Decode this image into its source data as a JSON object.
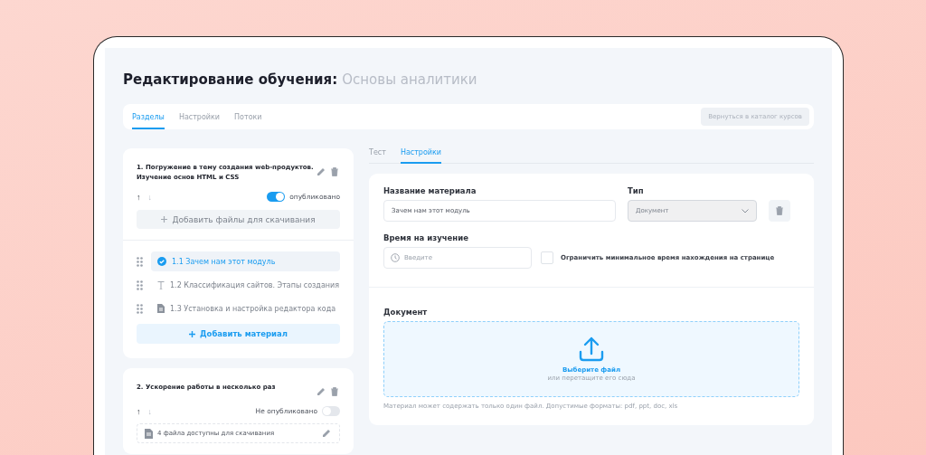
{
  "page": {
    "title": "Редактирование обучения:",
    "subtitle": "Основы аналитики"
  },
  "tabs": [
    {
      "label": "Разделы",
      "selected": true
    },
    {
      "label": "Настройки",
      "selected": false
    },
    {
      "label": "Потоки",
      "selected": false
    }
  ],
  "back_button": {
    "label": "Вернуться в каталог курсов",
    "disabled": true
  },
  "sections": [
    {
      "title": "1. Погружение в тему создания web-продуктов. Изучение основ HTML и CSS",
      "move_up": {
        "text": "↑",
        "disabled": false
      },
      "move_down": {
        "text": "↓",
        "disabled": true
      },
      "status_label": "опубликовано",
      "published": true,
      "add_files_button": "Добавить файлы для скачивания",
      "materials": [
        {
          "title": "1.1 Зачем нам этот модуль",
          "kind": "check",
          "selected": true
        },
        {
          "title": "1.2 Классификация сайтов. Этапы создания",
          "kind": "text",
          "selected": false
        },
        {
          "title": "1.3 Установка и настройка редактора кода",
          "kind": "doc",
          "selected": false
        }
      ],
      "add_material_button": "Добавить материал"
    },
    {
      "title": "2. Ускорение работы в несколько раз",
      "move_up": {
        "text": "↑",
        "disabled": false
      },
      "move_down": {
        "text": "↓",
        "disabled": true
      },
      "status_label": "Не опубликовано",
      "published": false,
      "files_note": "4 файла доступны для скачивания"
    }
  ],
  "content_tabs": [
    {
      "label": "Тест",
      "selected": false
    },
    {
      "label": "Настройки",
      "selected": true
    }
  ],
  "form": {
    "name_label": "Название материала",
    "name_value": "Зачем нам этот модуль",
    "type_label": "Тип",
    "type_value": "Документ",
    "time_label": "Время на изучение",
    "time_placeholder": "Введите",
    "limit_checkbox": {
      "label": "Ограничить минимальное время нахождения на странице",
      "checked": false
    },
    "document_label": "Документ",
    "upload_title": "Выберите файл",
    "upload_hint": "или перетащите его сюда",
    "note": "Материал может содержать только один файл. Допустимые форматы: pdf, ppt, doc, xls"
  }
}
